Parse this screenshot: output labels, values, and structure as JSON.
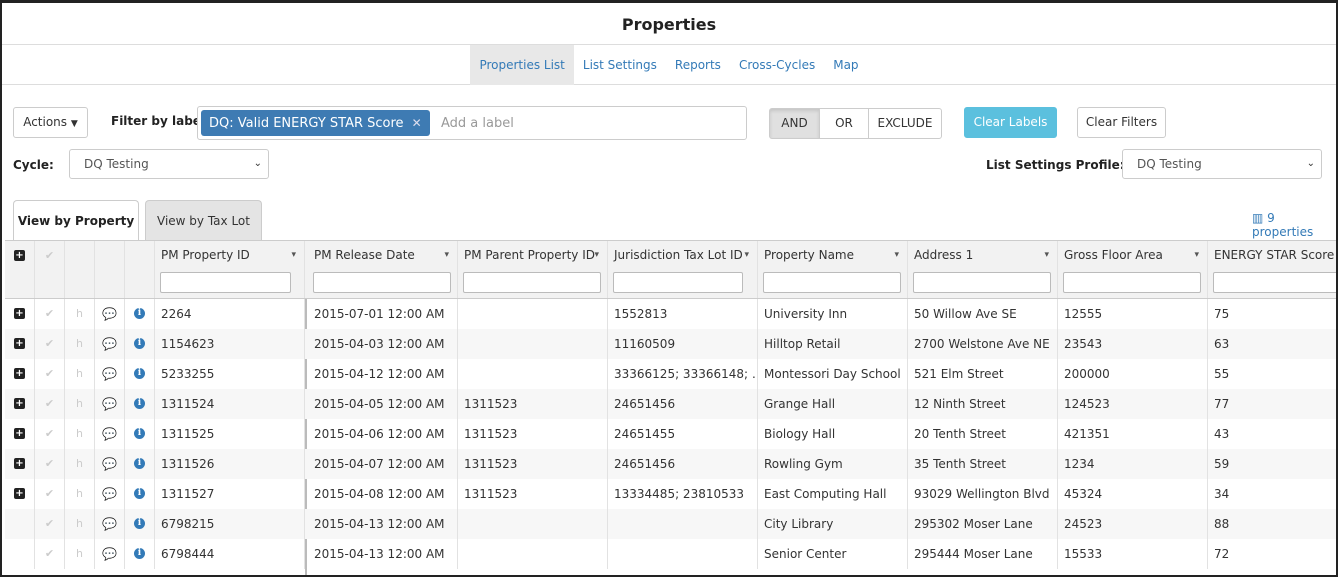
{
  "page": {
    "title": "Properties"
  },
  "subnav": {
    "tabs": [
      "Properties List",
      "List Settings",
      "Reports",
      "Cross-Cycles",
      "Map"
    ]
  },
  "toolbar": {
    "actions_label": "Actions",
    "filter_label": "Filter by label:",
    "chip_label": "DQ: Valid ENERGY STAR Score",
    "add_label_placeholder": "Add a label",
    "and_label": "AND",
    "or_label": "OR",
    "exclude_label": "EXCLUDE",
    "clear_labels": "Clear Labels",
    "clear_filters": "Clear Filters",
    "cycle_label": "Cycle:",
    "cycle_value": "DQ Testing",
    "profile_label": "List Settings Profile:",
    "profile_value": "DQ Testing"
  },
  "views": {
    "by_property": "View by Property",
    "by_taxlot": "View by Tax Lot",
    "count": "9 properties"
  },
  "colors": {
    "accent": "#337ab7",
    "chip": "#3e7bb3",
    "clear_labels": "#5bc0de"
  },
  "table": {
    "headers": [
      "PM Property ID",
      "PM Release Date",
      "PM Parent Property ID",
      "Jurisdiction Tax Lot ID",
      "Property Name",
      "Address 1",
      "Gross Floor Area",
      "ENERGY STAR Score"
    ],
    "rows": [
      {
        "expand": true,
        "cells": [
          "2264",
          "2015-07-01 12:00 AM",
          "",
          "1552813",
          "University Inn",
          "50 Willow Ave SE",
          "12555",
          "75"
        ]
      },
      {
        "expand": true,
        "cells": [
          "1154623",
          "2015-04-03 12:00 AM",
          "",
          "11160509",
          "Hilltop Retail",
          "2700 Welstone Ave NE",
          "23543",
          "63"
        ]
      },
      {
        "expand": true,
        "cells": [
          "5233255",
          "2015-04-12 12:00 AM",
          "",
          "33366125; 33366148; …",
          "Montessori Day School",
          "521 Elm Street",
          "200000",
          "55"
        ]
      },
      {
        "expand": true,
        "cells": [
          "1311524",
          "2015-04-05 12:00 AM",
          "1311523",
          "24651456",
          "Grange Hall",
          "12 Ninth Street",
          "124523",
          "77"
        ]
      },
      {
        "expand": true,
        "cells": [
          "1311525",
          "2015-04-06 12:00 AM",
          "1311523",
          "24651455",
          "Biology Hall",
          "20 Tenth Street",
          "421351",
          "43"
        ]
      },
      {
        "expand": true,
        "cells": [
          "1311526",
          "2015-04-07 12:00 AM",
          "1311523",
          "24651456",
          "Rowling Gym",
          "35 Tenth Street",
          "1234",
          "59"
        ]
      },
      {
        "expand": true,
        "cells": [
          "1311527",
          "2015-04-08 12:00 AM",
          "1311523",
          "13334485; 23810533",
          "East Computing Hall",
          "93029 Wellington Blvd",
          "45324",
          "34"
        ]
      },
      {
        "expand": false,
        "cells": [
          "6798215",
          "2015-04-13 12:00 AM",
          "",
          "",
          "City Library",
          "295302 Moser Lane",
          "24523",
          "88"
        ]
      },
      {
        "expand": false,
        "cells": [
          "6798444",
          "2015-04-13 12:00 AM",
          "",
          "",
          "Senior Center",
          "295444 Moser Lane",
          "15533",
          "72"
        ]
      }
    ]
  }
}
